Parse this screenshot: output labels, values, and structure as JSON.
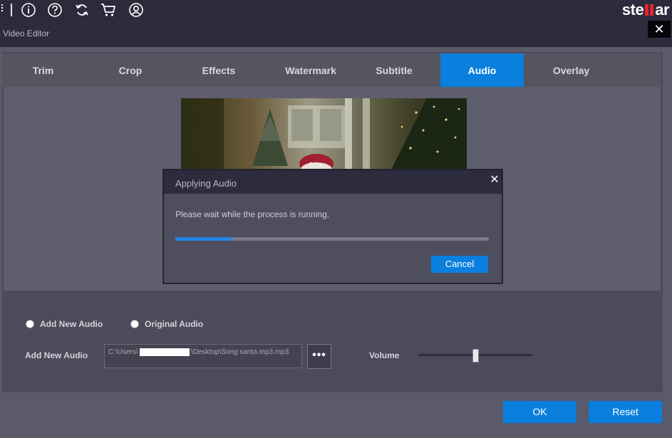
{
  "app": {
    "logo_text": "stellar",
    "logo_pre": "ste",
    "logo_post": "ar",
    "accent": "#0a7fde"
  },
  "toolbar": {
    "icons": [
      "info-icon",
      "help-icon",
      "refresh-icon",
      "cart-icon",
      "account-icon"
    ]
  },
  "window": {
    "title": "Video Editor",
    "close_label": "✕"
  },
  "tabs": [
    {
      "label": "Trim",
      "active": false
    },
    {
      "label": "Crop",
      "active": false
    },
    {
      "label": "Effects",
      "active": false
    },
    {
      "label": "Watermark",
      "active": false
    },
    {
      "label": "Subtitle",
      "active": false
    },
    {
      "label": "Audio",
      "active": true
    },
    {
      "label": "Overlay",
      "active": false
    }
  ],
  "audio": {
    "option_new": "Add New Audio",
    "option_original": "Original Audio",
    "add_label": "Add New Audio",
    "path_prefix": "C:\\Users\\",
    "path_suffix": "\\Desktop\\Song santa.mp3.mp3",
    "browse_label": "•••",
    "volume_label": "Volume",
    "volume_level": 0.5
  },
  "footer": {
    "ok_label": "OK",
    "reset_label": "Reset"
  },
  "dialog": {
    "title": "Applying Audio",
    "message": "Please wait while the process is running.",
    "progress": 0.18,
    "cancel_label": "Cancel",
    "close_label": "✕"
  }
}
